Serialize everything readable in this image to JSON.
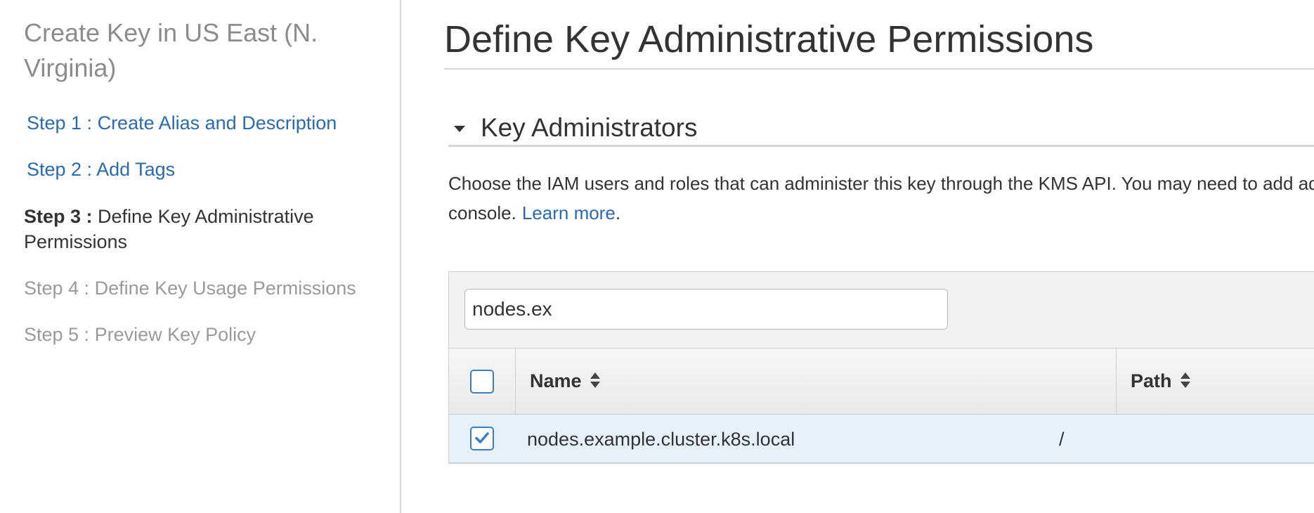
{
  "sidebar": {
    "title": "Create Key in US East (N. Virginia)",
    "steps": [
      {
        "label": "Step 1 : Create Alias and Description"
      },
      {
        "label": "Step 2 : Add Tags"
      },
      {
        "num": "Step 3 :",
        "label": "Define Key Administrative Permissions"
      },
      {
        "label": "Step 4 : Define Key Usage Permissions"
      },
      {
        "label": "Step 5 : Preview Key Policy"
      }
    ]
  },
  "main": {
    "page_title": "Define Key Administrative Permissions",
    "section": {
      "title": "Key Administrators",
      "description": "Choose the IAM users and roles that can administer this key through the KMS API. You may need to add additional permissions for the users or roles to administer this key from this",
      "description_end": "console.",
      "learn_more": "Learn more",
      "period": "."
    },
    "table": {
      "filter_value": "nodes.ex",
      "columns": [
        {
          "label": "Name"
        },
        {
          "label": "Path"
        }
      ],
      "rows": [
        {
          "name": "nodes.example.cluster.k8s.local",
          "path": "/",
          "selected": true
        }
      ]
    }
  },
  "colors": {
    "link": "#2a6ab0",
    "checkbox": "#3a7ec9",
    "row_selected": "#e6f1fb"
  }
}
